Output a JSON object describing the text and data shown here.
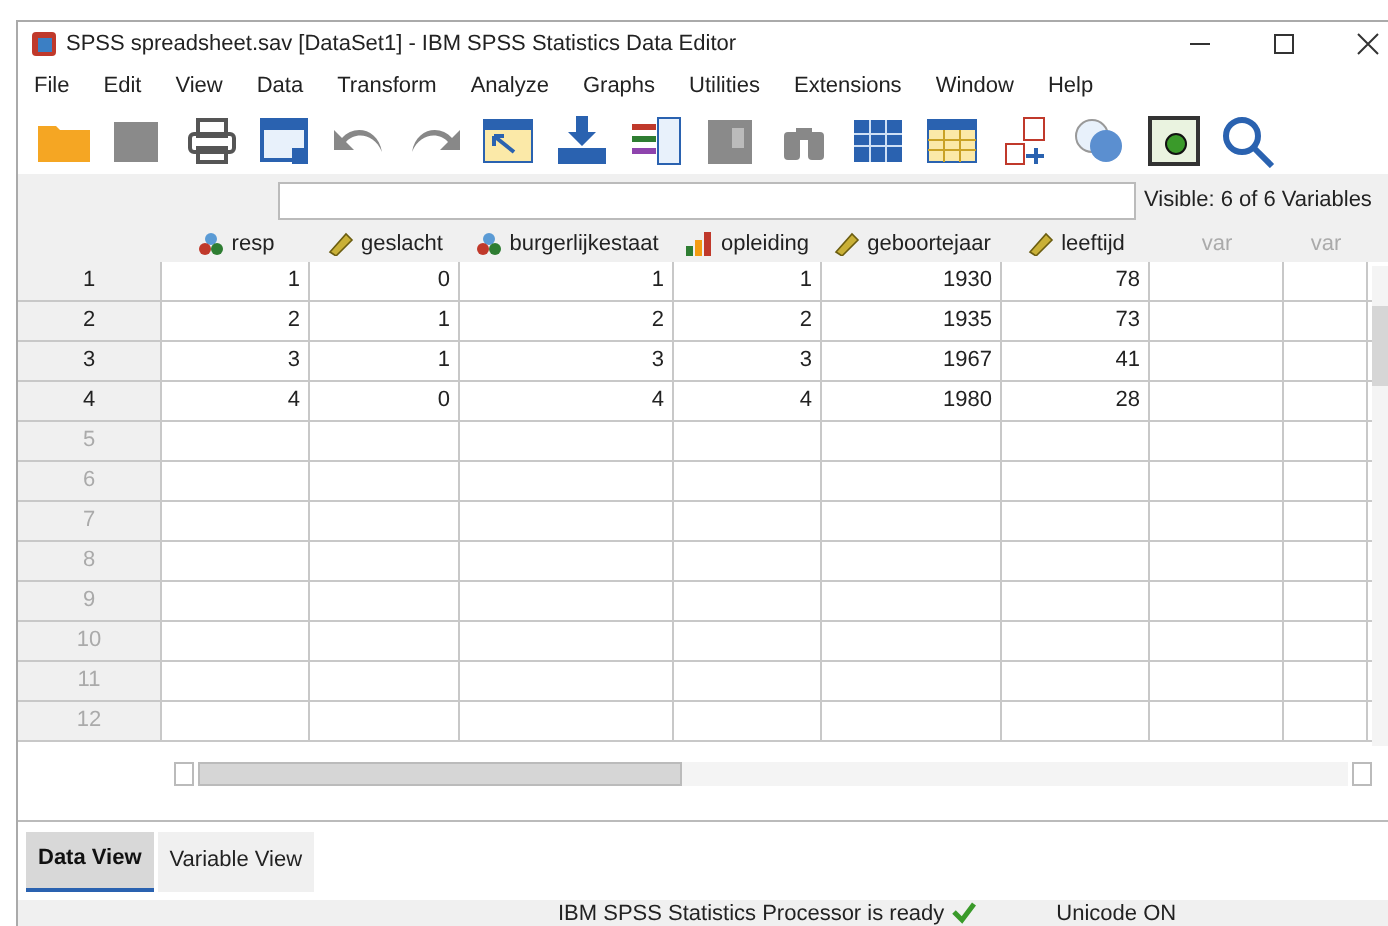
{
  "window": {
    "title": "SPSS spreadsheet.sav [DataSet1] - IBM SPSS Statistics Data Editor"
  },
  "menu": [
    "File",
    "Edit",
    "View",
    "Data",
    "Transform",
    "Analyze",
    "Graphs",
    "Utilities",
    "Extensions",
    "Window",
    "Help"
  ],
  "visible_label": "Visible: 6 of 6 Variables",
  "columns": [
    {
      "name": "resp",
      "kind": "nominal"
    },
    {
      "name": "geslacht",
      "kind": "scale"
    },
    {
      "name": "burgerlijkestaat",
      "kind": "nominal"
    },
    {
      "name": "opleiding",
      "kind": "ordinal"
    },
    {
      "name": "geboortejaar",
      "kind": "scale"
    },
    {
      "name": "leeftijd",
      "kind": "scale"
    },
    {
      "name": "var",
      "kind": "empty"
    },
    {
      "name": "var",
      "kind": "empty"
    }
  ],
  "rows": [
    {
      "number": "1",
      "cells": [
        "1",
        "0",
        "1",
        "1",
        "1930",
        "78"
      ]
    },
    {
      "number": "2",
      "cells": [
        "2",
        "1",
        "2",
        "2",
        "1935",
        "73"
      ]
    },
    {
      "number": "3",
      "cells": [
        "3",
        "1",
        "3",
        "3",
        "1967",
        "41"
      ]
    },
    {
      "number": "4",
      "cells": [
        "4",
        "0",
        "4",
        "4",
        "1980",
        "28"
      ]
    },
    {
      "number": "5",
      "cells": []
    },
    {
      "number": "6",
      "cells": []
    },
    {
      "number": "7",
      "cells": []
    },
    {
      "number": "8",
      "cells": []
    },
    {
      "number": "9",
      "cells": []
    },
    {
      "number": "10",
      "cells": []
    },
    {
      "number": "11",
      "cells": []
    },
    {
      "number": "12",
      "cells": []
    }
  ],
  "tabs": [
    {
      "label": "Data View",
      "selected": true
    },
    {
      "label": "Variable View",
      "selected": false
    }
  ],
  "status_bar": {
    "processor": "IBM SPSS Statistics Processor is ready",
    "unicode": "Unicode ON"
  }
}
